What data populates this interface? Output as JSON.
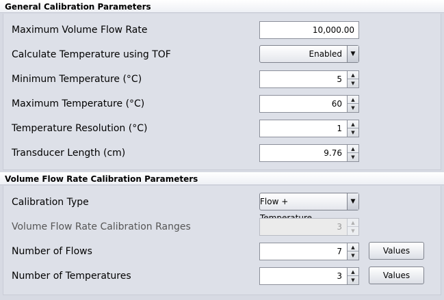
{
  "general": {
    "title": "General Calibration Parameters",
    "max_flow_label": "Maximum Volume Flow Rate",
    "max_flow_value": "10,000.00",
    "calc_temp_label": "Calculate Temperature using TOF",
    "calc_temp_value": "Enabled",
    "min_temp_label": "Minimum Temperature (°C)",
    "min_temp_value": "5",
    "max_temp_label": "Maximum Temperature (°C)",
    "max_temp_value": "60",
    "temp_res_label": "Temperature Resolution (°C)",
    "temp_res_value": "1",
    "transducer_label": "Transducer Length (cm)",
    "transducer_value": "9.76"
  },
  "volume": {
    "title": "Volume Flow Rate Calibration Parameters",
    "cal_type_label": "Calibration Type",
    "cal_type_value": "Flow + Temperature",
    "ranges_label": "Volume Flow Rate Calibration Ranges",
    "ranges_value": "3",
    "num_flows_label": "Number of Flows",
    "num_flows_value": "7",
    "num_temps_label": "Number of Temperatures",
    "num_temps_value": "3",
    "values_button": "Values"
  }
}
